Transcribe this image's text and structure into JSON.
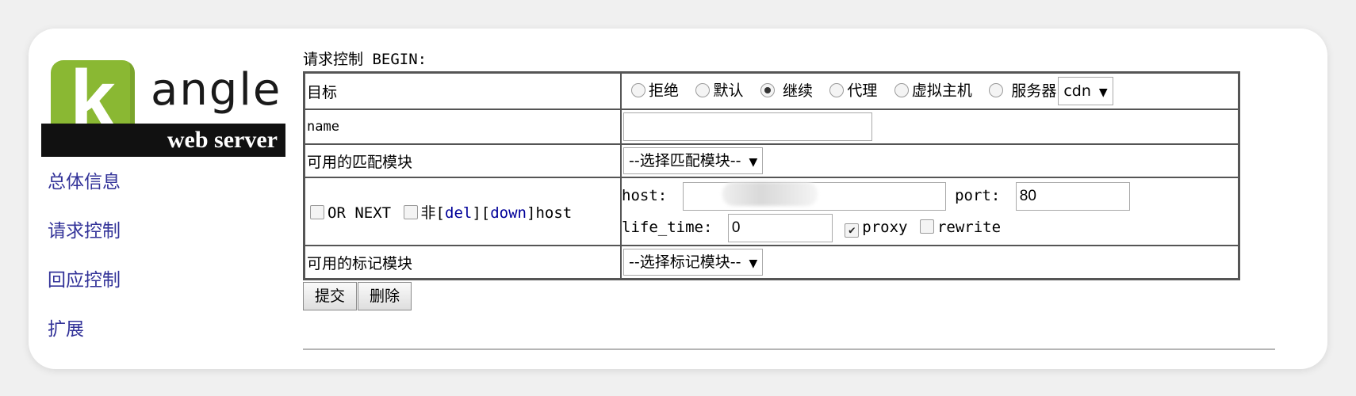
{
  "logo": {
    "letter": "k",
    "word": "angle",
    "subtitle": "web server"
  },
  "sidebar": {
    "items": [
      {
        "label": "总体信息"
      },
      {
        "label": "请求控制"
      },
      {
        "label": "回应控制"
      },
      {
        "label": "扩展"
      }
    ]
  },
  "form": {
    "heading": "请求控制 BEGIN:",
    "target": {
      "label": "目标",
      "options": [
        {
          "label": "拒绝",
          "checked": false
        },
        {
          "label": "默认",
          "checked": false
        },
        {
          "label": "继续",
          "checked": true
        },
        {
          "label": "代理",
          "checked": false
        },
        {
          "label": "虚拟主机",
          "checked": false
        },
        {
          "label": "服务器",
          "checked": false
        }
      ],
      "server_select": "cdn"
    },
    "name": {
      "label": "name",
      "value": ""
    },
    "match_module": {
      "label": "可用的匹配模块",
      "select": "--选择匹配模块--"
    },
    "match_row": {
      "or_next_label": "OR NEXT",
      "not_label": "非",
      "del_label": "del",
      "down_label": "down",
      "host_word": "host",
      "host_label": "host:",
      "host_value": "",
      "port_label": "port:",
      "port_value": "80",
      "life_time_label": "life_time:",
      "life_time_value": "0",
      "proxy_label": "proxy",
      "proxy_checked": true,
      "rewrite_label": "rewrite",
      "rewrite_checked": false
    },
    "mark_module": {
      "label": "可用的标记模块",
      "select": "--选择标记模块--"
    },
    "buttons": {
      "submit": "提交",
      "delete": "删除"
    }
  },
  "icons": {
    "select_arrow": "chevron-down-icon",
    "checkmark": "check-icon"
  },
  "colors": {
    "logo_green": "#8ab833",
    "nav_link": "#333399",
    "action_link": "#000099"
  }
}
